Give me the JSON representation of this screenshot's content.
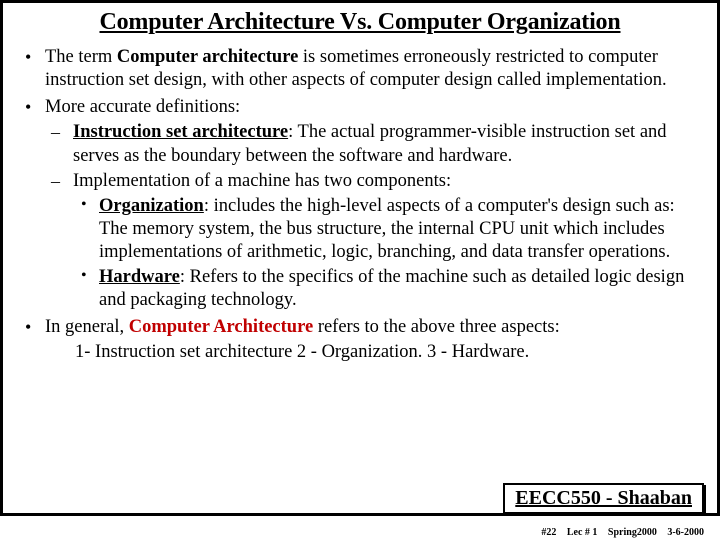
{
  "title": "Computer Architecture Vs. Computer Organization",
  "b1": {
    "pre": "The term ",
    "bold": "Computer architecture",
    "post": " is sometimes erroneously restricted to computer instruction set design, with other aspects of computer design called implementation."
  },
  "b2": {
    "text": "More accurate definitions:",
    "isa": {
      "label": " Instruction set architecture",
      "rest": ":  The actual programmer-visible instruction set and serves as the boundary between the software and hardware."
    },
    "impl": {
      "text": "Implementation of a machine has two components:",
      "org": {
        "label": "Organization",
        "rest": ":  includes the high-level aspects of a computer's design such as: The memory system, the bus structure, the internal CPU unit which includes implementations of arithmetic, logic, branching, and data transfer operations."
      },
      "hw": {
        "label": "Hardware",
        "rest": ": Refers to the specifics of the machine such as detailed logic design and packaging technology."
      }
    }
  },
  "b3": {
    "pre": "In general, ",
    "bold": "Computer Architecture",
    "post": " refers to the above three aspects:",
    "line": "1- Instruction set architecture   2 - Organization.   3 - Hardware."
  },
  "course": "EECC550 - Shaaban",
  "footer": {
    "page": "#22",
    "lec": "Lec # 1",
    "term": "Spring2000",
    "date": "3-6-2000"
  }
}
